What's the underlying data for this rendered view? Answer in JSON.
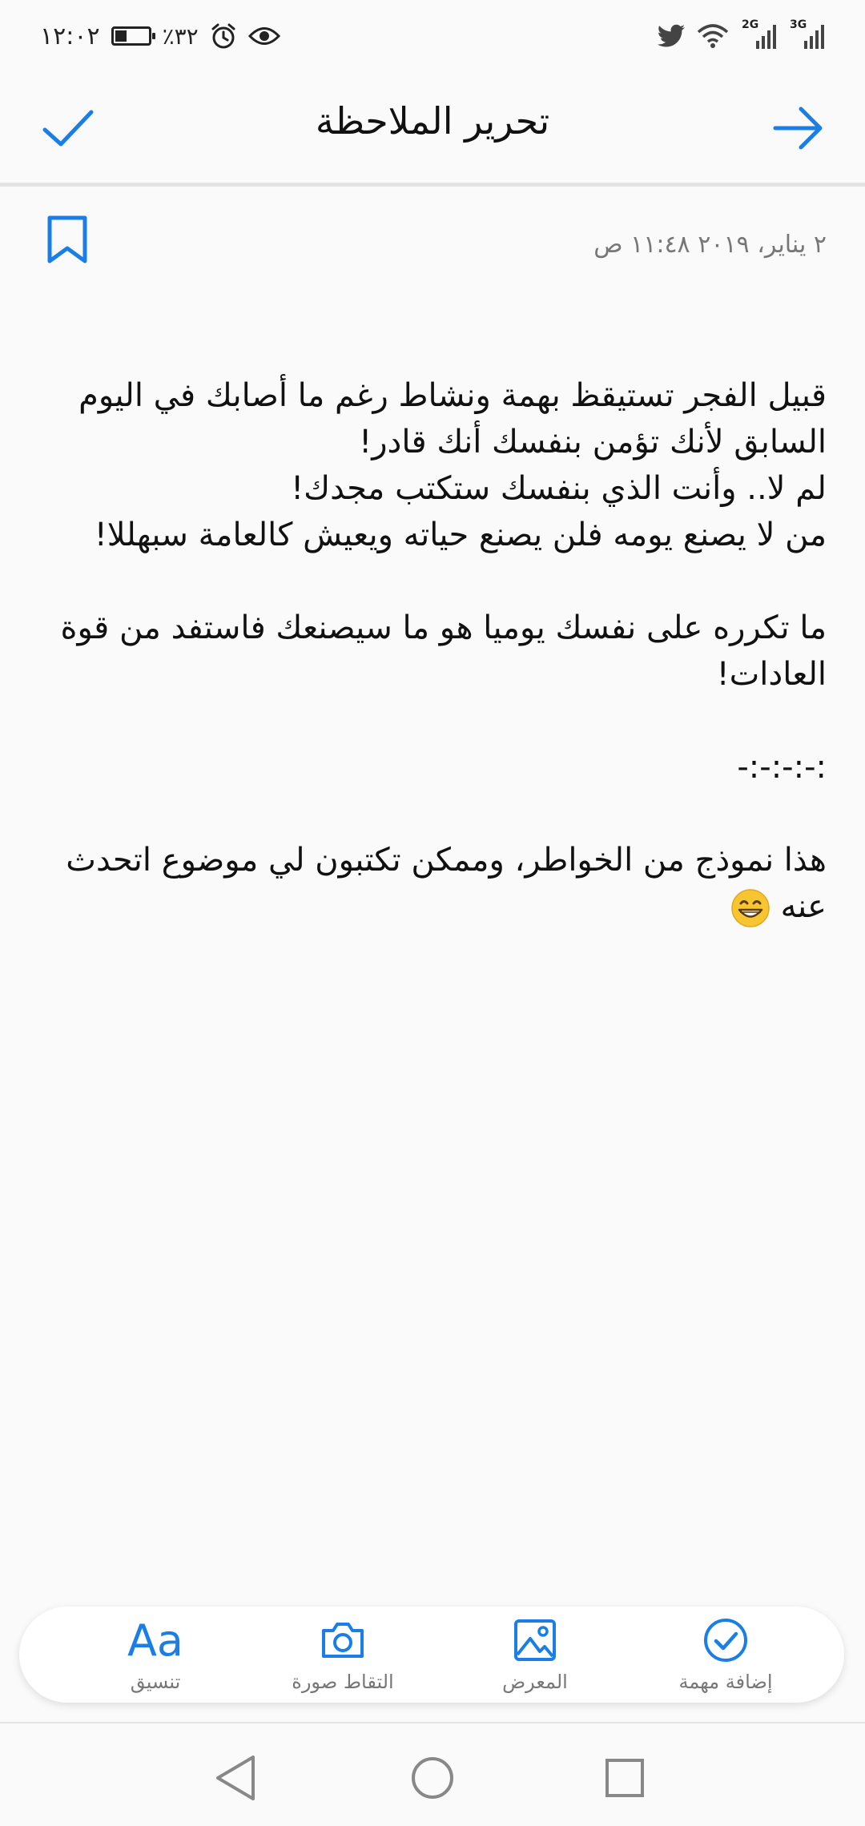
{
  "status_bar": {
    "time": "١٢:٠٢",
    "battery_percent": "٪٣٢",
    "battery_level": 0.32,
    "network_1": "2G",
    "network_2": "3G",
    "icons": [
      "eye-icon",
      "alarm-icon",
      "battery-icon",
      "twitter-icon",
      "wifi-icon",
      "signal-icon"
    ]
  },
  "app_bar": {
    "title": "تحرير الملاحظة"
  },
  "note": {
    "date": "٢ يناير، ٢٠١٩ ١١:٤٨ ص",
    "lines": [
      "قبيل الفجر تستيقظ بهمة ونشاط رغم ما أصابك في اليوم السابق لأنك تؤمن بنفسك أنك قادر!",
      "لم لا.. وأنت الذي بنفسك ستكتب مجدك!",
      "من لا يصنع يومه فلن يصنع حياته ويعيش كالعامة سبهللا!",
      "",
      "ما تكرره على نفسك يوميا هو ما سيصنعك فاستفد من قوة العادات!",
      "",
      "-:-:-:-:",
      "",
      "هذا نموذج من الخواطر، وممكن تكتبون لي موضوع اتحدث عنه"
    ]
  },
  "toolbar": {
    "format_glyph": "Aa",
    "format_label": "تنسيق",
    "camera_label": "التقاط صورة",
    "gallery_label": "المعرض",
    "task_label": "إضافة مهمة"
  },
  "colors": {
    "accent": "#1a7ee6",
    "background": "#fafafa",
    "text": "#111111",
    "muted": "#777777"
  }
}
